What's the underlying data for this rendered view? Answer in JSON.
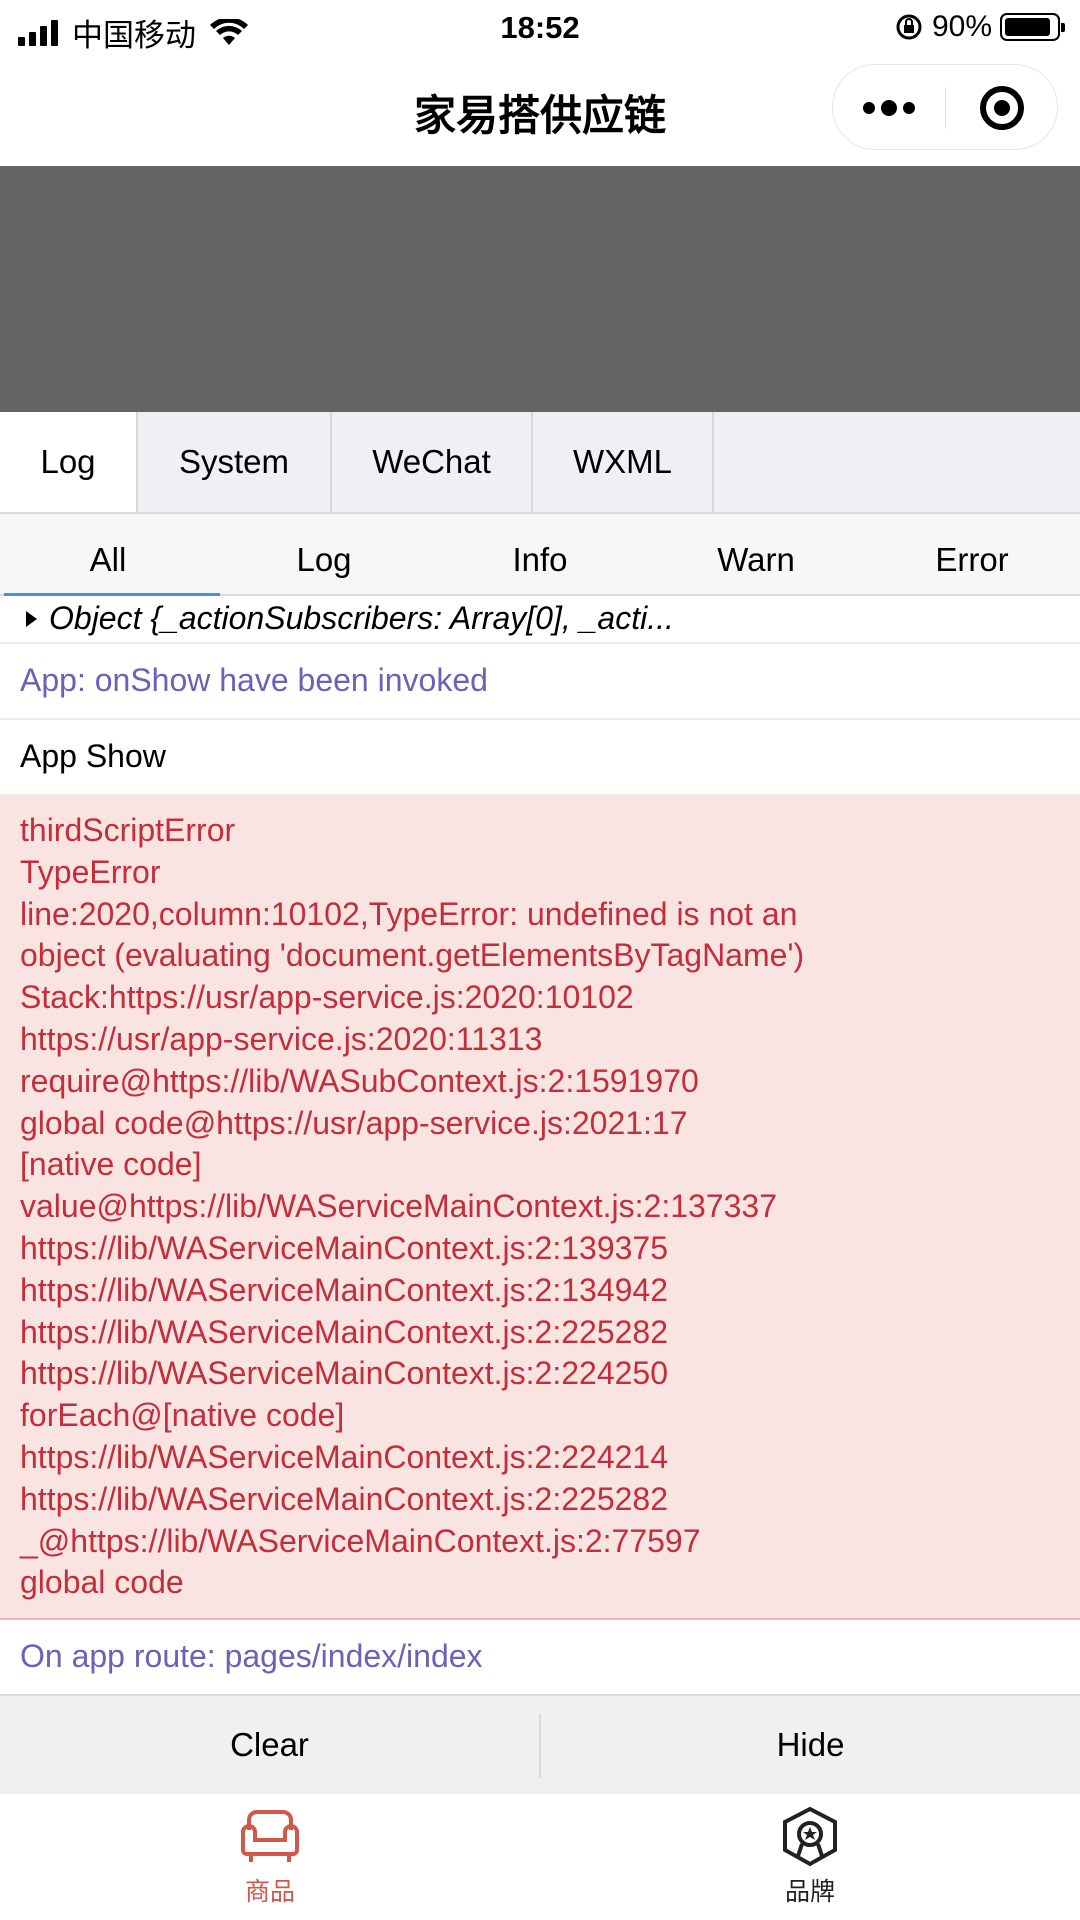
{
  "status_bar": {
    "carrier": "中国移动",
    "time": "18:52",
    "battery": "90%",
    "battery_level": 0.9
  },
  "nav": {
    "title": "家易搭供应链"
  },
  "vconsole": {
    "tabs": [
      "Log",
      "System",
      "WeChat",
      "WXML"
    ],
    "active_tab": "Log",
    "filters": [
      "All",
      "Log",
      "Info",
      "Warn",
      "Error"
    ],
    "active_filter": "All",
    "logs": {
      "object_line": "Object {_actionSubscribers: Array[0], _acti...",
      "onshow": "App: onShow have been invoked",
      "app_show": "App Show",
      "error_lines": [
        "thirdScriptError",
        "TypeError",
        "line:2020,column:10102,TypeError: undefined is not an",
        "object (evaluating 'document.getElementsByTagName')",
        "Stack:https://usr/app-service.js:2020:10102",
        "https://usr/app-service.js:2020:11313",
        "require@https://lib/WASubContext.js:2:1591970",
        "global code@https://usr/app-service.js:2021:17",
        "[native code]",
        "value@https://lib/WAServiceMainContext.js:2:137337",
        "https://lib/WAServiceMainContext.js:2:139375",
        "https://lib/WAServiceMainContext.js:2:134942",
        "https://lib/WAServiceMainContext.js:2:225282",
        "https://lib/WAServiceMainContext.js:2:224250",
        "forEach@[native code]",
        "https://lib/WAServiceMainContext.js:2:224214",
        "https://lib/WAServiceMainContext.js:2:225282",
        "_@https://lib/WAServiceMainContext.js:2:77597",
        "global code"
      ],
      "route": "On app route: pages/index/index"
    },
    "buttons": {
      "clear": "Clear",
      "hide": "Hide"
    }
  },
  "tabbar": {
    "items": [
      {
        "label": "商品",
        "icon": "sofa-icon",
        "active": true
      },
      {
        "label": "品牌",
        "icon": "brand-badge-icon",
        "active": false
      }
    ]
  },
  "colors": {
    "info_text": "#6a62b6",
    "error_text": "#c42d3a",
    "error_bg": "#f9e4e1",
    "active_tab_color": "#d0574a",
    "filter_underline": "#4a90e2"
  }
}
